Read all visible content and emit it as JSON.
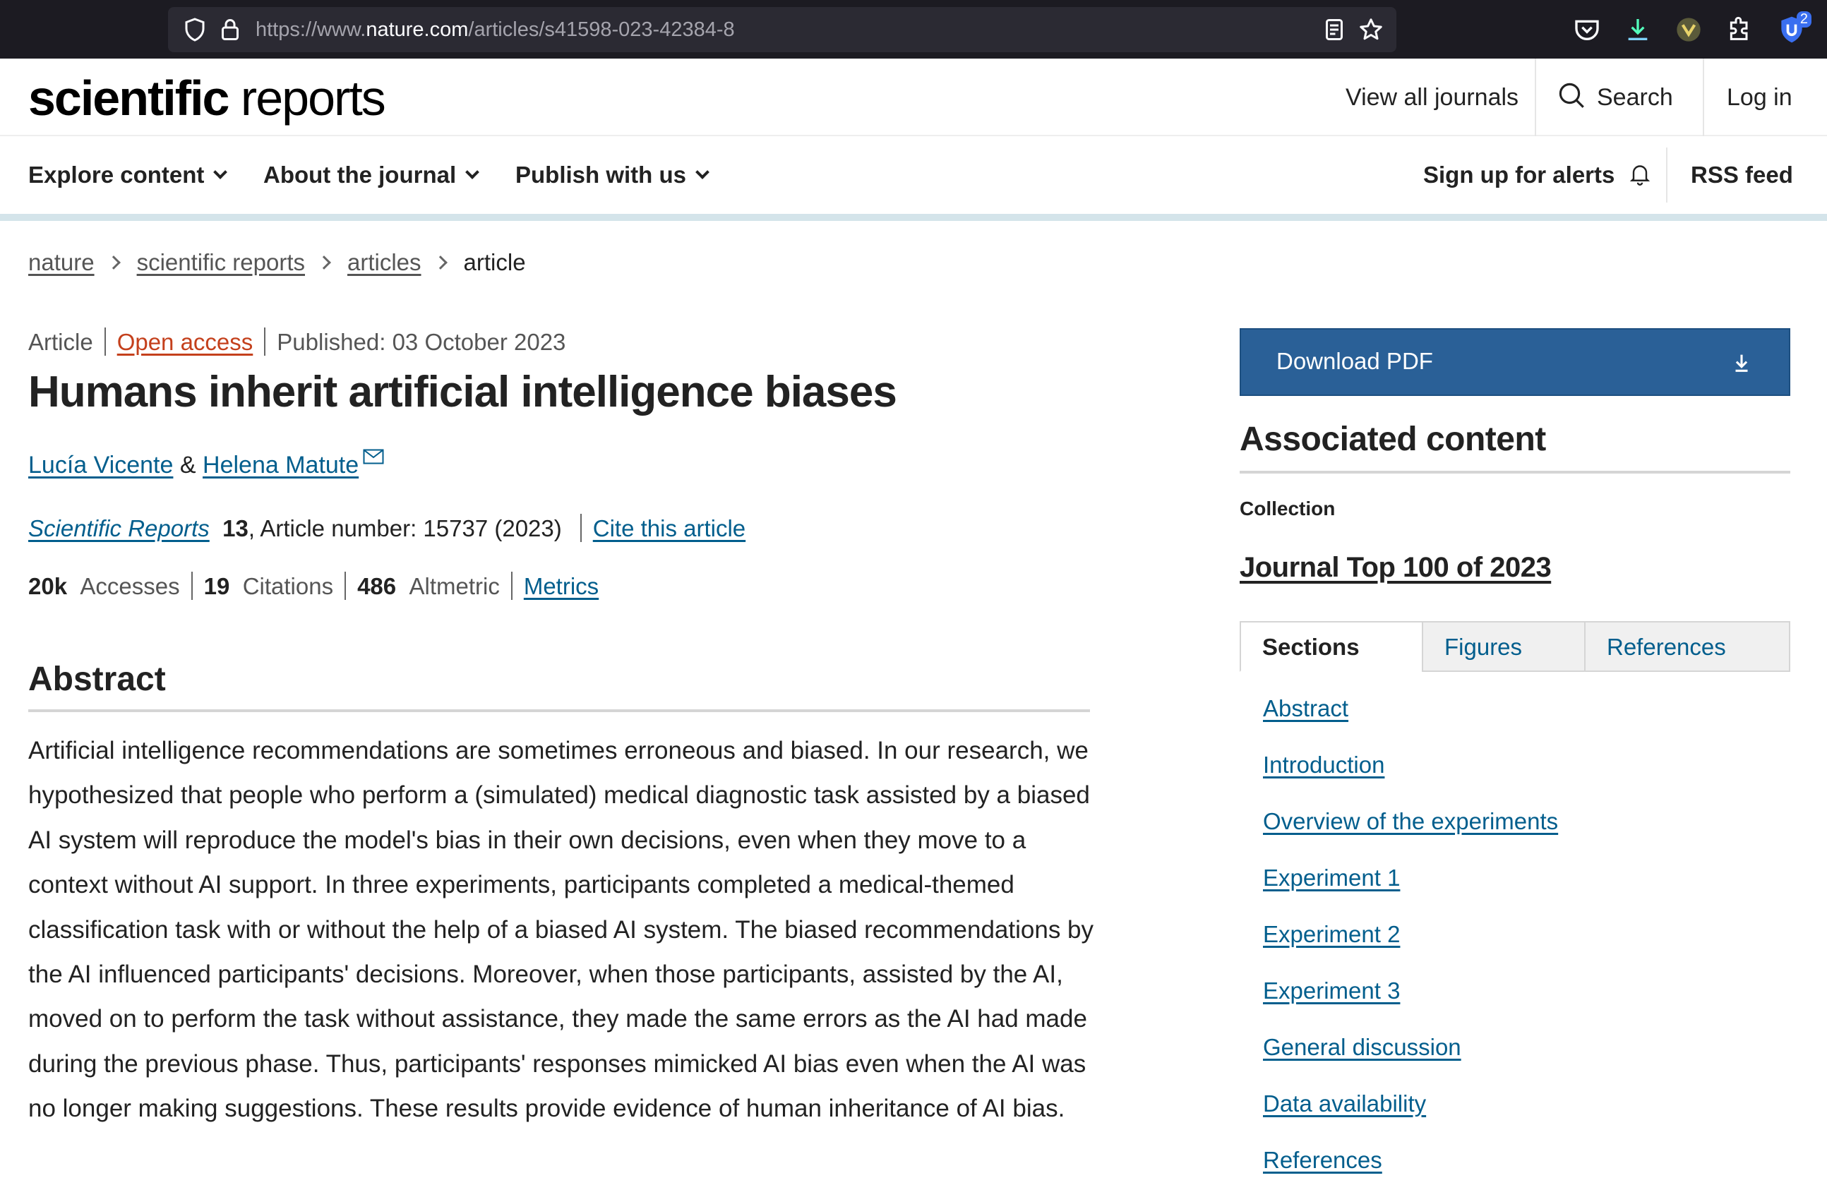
{
  "browser": {
    "url_prefix": "https://www.",
    "url_domain": "nature.com",
    "url_path": "/articles/s41598-023-42384-8",
    "badge_count": "2"
  },
  "header": {
    "logo_bold": "scientific",
    "logo_light": "reports",
    "view_all": "View all journals",
    "search": "Search",
    "login": "Log in"
  },
  "nav": {
    "explore": "Explore content",
    "about": "About the journal",
    "publish": "Publish with us",
    "alerts": "Sign up for alerts",
    "rss": "RSS feed"
  },
  "breadcrumb": [
    "nature",
    "scientific reports",
    "articles",
    "article"
  ],
  "article": {
    "type": "Article",
    "open_access": "Open access",
    "published": "Published: 03 October 2023",
    "title": "Humans inherit artificial intelligence biases",
    "author1": "Lucía Vicente",
    "amp": "&",
    "author2": "Helena Matute",
    "journal": "Scientific Reports",
    "volume": "13",
    "article_number": ", Article number: 15737 (2023)",
    "cite": "Cite this article",
    "accesses_num": "20k",
    "accesses_label": "Accesses",
    "citations_num": "19",
    "citations_label": "Citations",
    "altmetric_num": "486",
    "altmetric_label": "Altmetric",
    "metrics": "Metrics"
  },
  "abstract": {
    "heading": "Abstract",
    "text": "Artificial intelligence recommendations are sometimes erroneous and biased. In our research, we hypothesized that people who perform a (simulated) medical diagnostic task assisted by a biased AI system will reproduce the model's bias in their own decisions, even when they move to a context without AI support. In three experiments, participants completed a medical-themed classification task with or without the help of a biased AI system. The biased recommendations by the AI influenced participants' decisions. Moreover, when those participants, assisted by the AI, moved on to perform the task without assistance, they made the same errors as the AI had made during the previous phase. Thus, participants' responses mimicked AI bias even when the AI was no longer making suggestions. These results provide evidence of human inheritance of AI bias."
  },
  "sidebar": {
    "download": "Download PDF",
    "assoc_heading": "Associated content",
    "collection_label": "Collection",
    "collection_link": "Journal Top 100 of 2023",
    "tabs": [
      "Sections",
      "Figures",
      "References"
    ],
    "toc": [
      "Abstract",
      "Introduction",
      "Overview of the experiments",
      "Experiment 1",
      "Experiment 2",
      "Experiment 3",
      "General discussion",
      "Data availability",
      "References"
    ]
  },
  "colors": {
    "link_blue": "#025e8d",
    "open_access": "#c4401c",
    "download_bg": "#2a6097"
  }
}
